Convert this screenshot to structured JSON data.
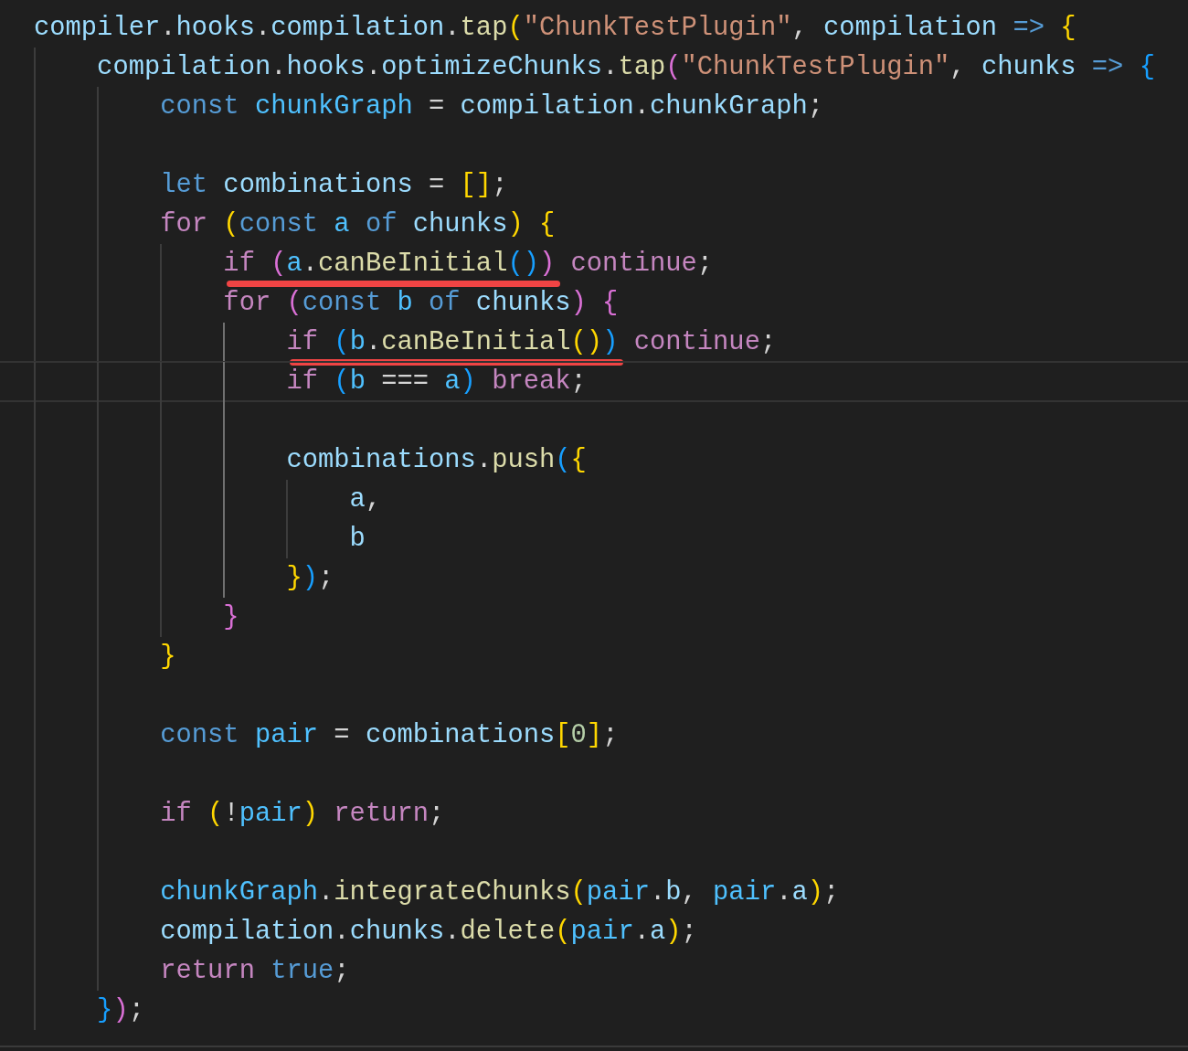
{
  "editor": {
    "lines": [
      {
        "current": false,
        "tokens": [
          {
            "kind": "var",
            "text": "compiler"
          },
          {
            "kind": "punct",
            "text": "."
          },
          {
            "kind": "var",
            "text": "hooks"
          },
          {
            "kind": "punct",
            "text": "."
          },
          {
            "kind": "var",
            "text": "compilation"
          },
          {
            "kind": "punct",
            "text": "."
          },
          {
            "kind": "fn",
            "text": "tap"
          },
          {
            "kind": "b1",
            "text": "("
          },
          {
            "kind": "str",
            "text": "\"ChunkTestPlugin\""
          },
          {
            "kind": "punct",
            "text": ", "
          },
          {
            "kind": "var",
            "text": "compilation"
          },
          {
            "kind": "kw",
            "text": " => "
          },
          {
            "kind": "b1",
            "text": "{"
          }
        ]
      },
      {
        "current": false,
        "tokens": [
          {
            "kind": "var",
            "text": "    compilation"
          },
          {
            "kind": "punct",
            "text": "."
          },
          {
            "kind": "var",
            "text": "hooks"
          },
          {
            "kind": "punct",
            "text": "."
          },
          {
            "kind": "var",
            "text": "optimizeChunks"
          },
          {
            "kind": "punct",
            "text": "."
          },
          {
            "kind": "fn",
            "text": "tap"
          },
          {
            "kind": "b2",
            "text": "("
          },
          {
            "kind": "str",
            "text": "\"ChunkTestPlugin\""
          },
          {
            "kind": "punct",
            "text": ", "
          },
          {
            "kind": "var",
            "text": "chunks"
          },
          {
            "kind": "kw",
            "text": " => "
          },
          {
            "kind": "b3",
            "text": "{"
          }
        ]
      },
      {
        "current": false,
        "tokens": [
          {
            "kind": "kw",
            "text": "        const"
          },
          {
            "kind": "const",
            "text": " chunkGraph"
          },
          {
            "kind": "punct",
            "text": " = "
          },
          {
            "kind": "var",
            "text": "compilation"
          },
          {
            "kind": "punct",
            "text": "."
          },
          {
            "kind": "var",
            "text": "chunkGraph"
          },
          {
            "kind": "punct",
            "text": ";"
          }
        ]
      },
      {
        "current": false
      },
      {
        "current": false,
        "tokens": [
          {
            "kind": "kw",
            "text": "        let"
          },
          {
            "kind": "var",
            "text": " combinations"
          },
          {
            "kind": "punct",
            "text": " = "
          },
          {
            "kind": "b1",
            "text": "[]"
          },
          {
            "kind": "punct",
            "text": ";"
          }
        ]
      },
      {
        "current": false,
        "tokens": [
          {
            "kind": "ctl",
            "text": "        for"
          },
          {
            "kind": "b1",
            "text": " ("
          },
          {
            "kind": "kw",
            "text": "const"
          },
          {
            "kind": "const",
            "text": " a"
          },
          {
            "kind": "kw",
            "text": " of"
          },
          {
            "kind": "var",
            "text": " chunks"
          },
          {
            "kind": "b1",
            "text": ")"
          },
          {
            "kind": "b1",
            "text": " {"
          }
        ]
      },
      {
        "current": false,
        "tokens": [
          {
            "kind": "underlined",
            "tokens": [
              {
                "kind": "ctl",
                "text": "            if"
              },
              {
                "kind": "b2",
                "text": " ("
              },
              {
                "kind": "const",
                "text": "a"
              },
              {
                "kind": "punct",
                "text": "."
              },
              {
                "kind": "fn",
                "text": "canBeInitial"
              },
              {
                "kind": "b3",
                "text": "()"
              },
              {
                "kind": "b2",
                "text": ")"
              }
            ]
          },
          {
            "kind": "ctl",
            "text": " continue"
          },
          {
            "kind": "punct",
            "text": ";"
          }
        ]
      },
      {
        "current": false,
        "tokens": [
          {
            "kind": "ctl",
            "text": "            for"
          },
          {
            "kind": "b2",
            "text": " ("
          },
          {
            "kind": "kw",
            "text": "const"
          },
          {
            "kind": "const",
            "text": " b"
          },
          {
            "kind": "kw",
            "text": " of"
          },
          {
            "kind": "var",
            "text": " chunks"
          },
          {
            "kind": "b2",
            "text": ")"
          },
          {
            "kind": "b2",
            "text": " {"
          }
        ]
      },
      {
        "current": false,
        "tokens": [
          {
            "kind": "underlined",
            "tokens": [
              {
                "kind": "ctl",
                "text": "                if"
              },
              {
                "kind": "b3",
                "text": " ("
              },
              {
                "kind": "const",
                "text": "b"
              },
              {
                "kind": "punct",
                "text": "."
              },
              {
                "kind": "fn",
                "text": "canBeInitial"
              },
              {
                "kind": "b1",
                "text": "()"
              },
              {
                "kind": "b3",
                "text": ")"
              }
            ]
          },
          {
            "kind": "ctl",
            "text": " continue"
          },
          {
            "kind": "punct",
            "text": ";"
          }
        ]
      },
      {
        "current": true,
        "tokens": [
          {
            "kind": "ctl",
            "text": "                if"
          },
          {
            "kind": "b3",
            "text": " ("
          },
          {
            "kind": "const",
            "text": "b"
          },
          {
            "kind": "punct",
            "text": " === "
          },
          {
            "kind": "const",
            "text": "a"
          },
          {
            "kind": "b3",
            "text": ")"
          },
          {
            "kind": "ctl",
            "text": " break"
          },
          {
            "kind": "punct",
            "text": ";"
          }
        ]
      },
      {
        "current": false
      },
      {
        "current": false,
        "tokens": [
          {
            "kind": "var",
            "text": "                combinations"
          },
          {
            "kind": "punct",
            "text": "."
          },
          {
            "kind": "fn",
            "text": "push"
          },
          {
            "kind": "b3",
            "text": "("
          },
          {
            "kind": "b1",
            "text": "{"
          }
        ]
      },
      {
        "current": false,
        "tokens": [
          {
            "kind": "var",
            "text": "                    a"
          },
          {
            "kind": "punct",
            "text": ","
          }
        ]
      },
      {
        "current": false,
        "tokens": [
          {
            "kind": "var",
            "text": "                    b"
          }
        ]
      },
      {
        "current": false,
        "tokens": [
          {
            "kind": "b1",
            "text": "                }"
          },
          {
            "kind": "b3",
            "text": ")"
          },
          {
            "kind": "punct",
            "text": ";"
          }
        ]
      },
      {
        "current": false,
        "tokens": [
          {
            "kind": "b2",
            "text": "            }"
          }
        ]
      },
      {
        "current": false,
        "tokens": [
          {
            "kind": "b1",
            "text": "        }"
          }
        ]
      },
      {
        "current": false
      },
      {
        "current": false,
        "tokens": [
          {
            "kind": "kw",
            "text": "        const"
          },
          {
            "kind": "const",
            "text": " pair"
          },
          {
            "kind": "punct",
            "text": " = "
          },
          {
            "kind": "var",
            "text": "combinations"
          },
          {
            "kind": "b1",
            "text": "["
          },
          {
            "kind": "num",
            "text": "0"
          },
          {
            "kind": "b1",
            "text": "]"
          },
          {
            "kind": "punct",
            "text": ";"
          }
        ]
      },
      {
        "current": false
      },
      {
        "current": false,
        "tokens": [
          {
            "kind": "ctl",
            "text": "        if"
          },
          {
            "kind": "b1",
            "text": " ("
          },
          {
            "kind": "punct",
            "text": "!"
          },
          {
            "kind": "const",
            "text": "pair"
          },
          {
            "kind": "b1",
            "text": ")"
          },
          {
            "kind": "ctl",
            "text": " return"
          },
          {
            "kind": "punct",
            "text": ";"
          }
        ]
      },
      {
        "current": false
      },
      {
        "current": false,
        "tokens": [
          {
            "kind": "const",
            "text": "        chunkGraph"
          },
          {
            "kind": "punct",
            "text": "."
          },
          {
            "kind": "fn",
            "text": "integrateChunks"
          },
          {
            "kind": "b1",
            "text": "("
          },
          {
            "kind": "const",
            "text": "pair"
          },
          {
            "kind": "punct",
            "text": "."
          },
          {
            "kind": "var",
            "text": "b"
          },
          {
            "kind": "punct",
            "text": ", "
          },
          {
            "kind": "const",
            "text": "pair"
          },
          {
            "kind": "punct",
            "text": "."
          },
          {
            "kind": "var",
            "text": "a"
          },
          {
            "kind": "b1",
            "text": ")"
          },
          {
            "kind": "punct",
            "text": ";"
          }
        ]
      },
      {
        "current": false,
        "tokens": [
          {
            "kind": "var",
            "text": "        compilation"
          },
          {
            "kind": "punct",
            "text": "."
          },
          {
            "kind": "var",
            "text": "chunks"
          },
          {
            "kind": "punct",
            "text": "."
          },
          {
            "kind": "fn",
            "text": "delete"
          },
          {
            "kind": "b1",
            "text": "("
          },
          {
            "kind": "const",
            "text": "pair"
          },
          {
            "kind": "punct",
            "text": "."
          },
          {
            "kind": "var",
            "text": "a"
          },
          {
            "kind": "b1",
            "text": ")"
          },
          {
            "kind": "punct",
            "text": ";"
          }
        ]
      },
      {
        "current": false,
        "tokens": [
          {
            "kind": "ctl",
            "text": "        return"
          },
          {
            "kind": "kw",
            "text": " true"
          },
          {
            "kind": "punct",
            "text": ";"
          }
        ]
      },
      {
        "current": false,
        "tokens": [
          {
            "kind": "b3",
            "text": "    }"
          },
          {
            "kind": "b2",
            "text": ")"
          },
          {
            "kind": "punct",
            "text": ";"
          }
        ]
      }
    ]
  }
}
